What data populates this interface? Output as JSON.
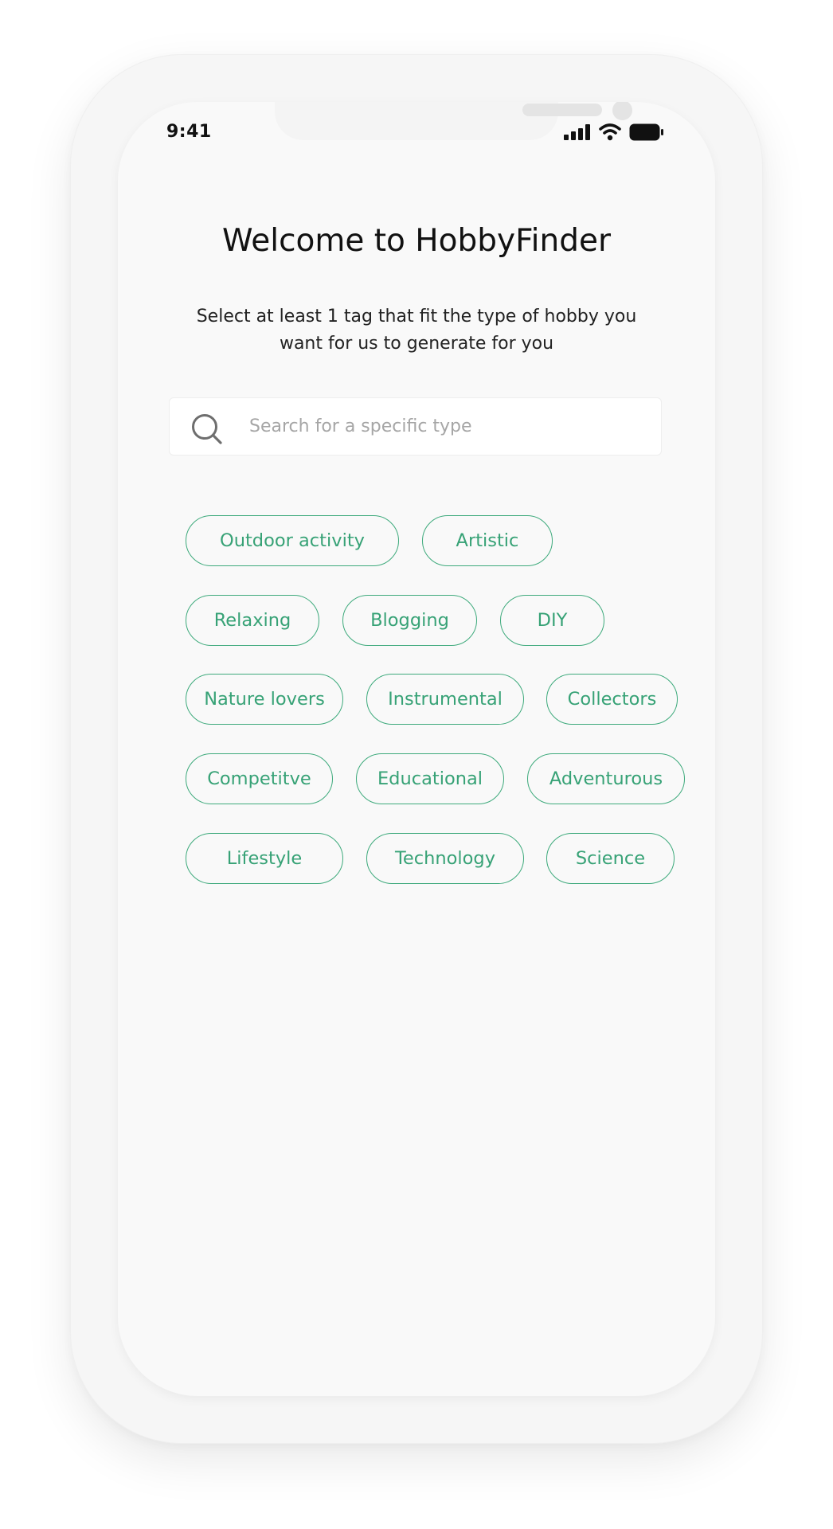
{
  "status_bar": {
    "time": "9:41",
    "icons": [
      "cellular-signal-icon",
      "wifi-icon",
      "battery-icon"
    ]
  },
  "main": {
    "title": "Welcome to HobbyFinder",
    "subtitle": "Select at least 1 tag that fit the type of hobby you want for us to generate for you"
  },
  "search": {
    "icon": "search-icon",
    "placeholder": "Search for a specific type",
    "value": ""
  },
  "tags": [
    "Outdoor activity",
    "Artistic",
    "Relaxing",
    "Blogging",
    "DIY",
    "Nature lovers",
    "Instrumental",
    "Collectors",
    "Competitve",
    "Educational",
    "Adventurous",
    "Lifestyle",
    "Technology",
    "Science"
  ],
  "colors": {
    "accent": "#3eaa7c",
    "tag_text": "#37a276",
    "screen_background": "#f9f9f9",
    "title_text": "#111111"
  }
}
